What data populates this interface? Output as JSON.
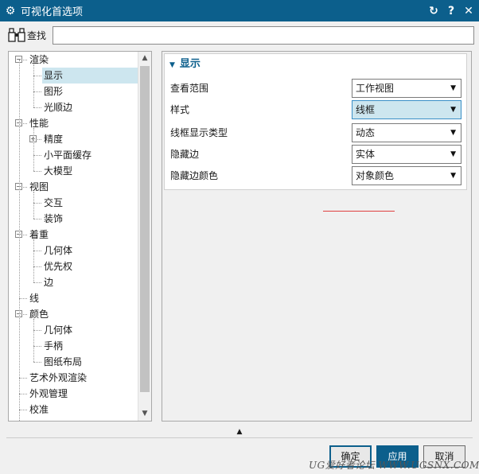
{
  "window": {
    "title": "可视化首选项",
    "icon": "gear-icon",
    "buttons": [
      "reset-icon",
      "help-icon",
      "close-icon"
    ]
  },
  "find": {
    "label": "查找",
    "value": "",
    "icon": "binoculars-icon"
  },
  "tree": {
    "nodes": [
      {
        "label": "渲染",
        "level": 0,
        "expanded": true
      },
      {
        "label": "显示",
        "level": 1,
        "selected": true
      },
      {
        "label": "图形",
        "level": 1
      },
      {
        "label": "光顺边",
        "level": 1
      },
      {
        "label": "性能",
        "level": 0,
        "expanded": true
      },
      {
        "label": "精度",
        "level": 1,
        "collapsed": true
      },
      {
        "label": "小平面缓存",
        "level": 1
      },
      {
        "label": "大模型",
        "level": 1
      },
      {
        "label": "视图",
        "level": 0,
        "expanded": true
      },
      {
        "label": "交互",
        "level": 1
      },
      {
        "label": "装饰",
        "level": 1
      },
      {
        "label": "着重",
        "level": 0,
        "expanded": true
      },
      {
        "label": "几何体",
        "level": 1
      },
      {
        "label": "优先权",
        "level": 1
      },
      {
        "label": "边",
        "level": 1
      },
      {
        "label": "线",
        "level": 0
      },
      {
        "label": "颜色",
        "level": 0,
        "expanded": true
      },
      {
        "label": "几何体",
        "level": 1
      },
      {
        "label": "手柄",
        "level": 1
      },
      {
        "label": "图纸布局",
        "level": 1
      },
      {
        "label": "艺术外观渲染",
        "level": 0
      },
      {
        "label": "外观管理",
        "level": 0
      },
      {
        "label": "校准",
        "level": 0
      }
    ]
  },
  "display_group": {
    "title": "显示",
    "rows": [
      {
        "label": "查看范围",
        "value": "工作视图"
      },
      {
        "label": "样式",
        "value": "线框",
        "highlighted": true
      },
      {
        "label": "线框显示类型",
        "value": "动态"
      },
      {
        "label": "隐藏边",
        "value": "实体"
      },
      {
        "label": "隐藏边颜色",
        "value": "对象颜色"
      }
    ]
  },
  "footer": {
    "ok_label": "确定",
    "apply_label": "应用",
    "cancel_label": "取消",
    "watermark": "UG爱好者论坛 WWW.UGSNX.COM"
  },
  "colors": {
    "accent": "#0c5f8c",
    "selection": "#cde6ef",
    "annotation_red": "#e04040"
  }
}
